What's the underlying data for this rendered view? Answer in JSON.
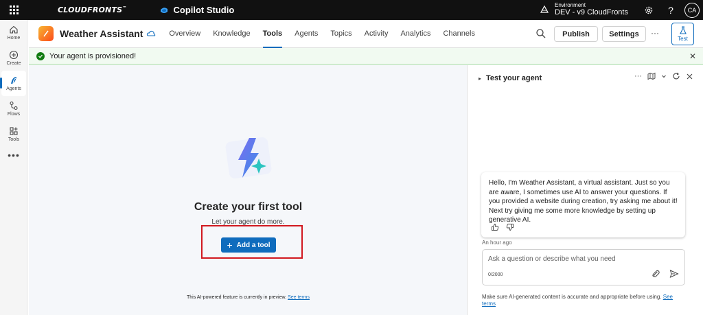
{
  "topbar": {
    "brand": "CLOUDFRONTS",
    "brand_mark": "™",
    "product": "Copilot Studio",
    "env_label": "Environment",
    "env_value": "DEV - v9 CloudFronts",
    "avatar_initials": "CA"
  },
  "rail": {
    "items": [
      {
        "label": "Home",
        "icon": "home-icon"
      },
      {
        "label": "Create",
        "icon": "plus-circle-icon"
      },
      {
        "label": "Agents",
        "icon": "agents-icon"
      },
      {
        "label": "Flows",
        "icon": "flows-icon"
      },
      {
        "label": "Tools",
        "icon": "tools-icon"
      }
    ],
    "more": "•••"
  },
  "header": {
    "agent_name": "Weather Assistant",
    "tabs": [
      {
        "label": "Overview"
      },
      {
        "label": "Knowledge"
      },
      {
        "label": "Tools"
      },
      {
        "label": "Agents"
      },
      {
        "label": "Topics"
      },
      {
        "label": "Activity"
      },
      {
        "label": "Analytics"
      },
      {
        "label": "Channels"
      }
    ],
    "active_tab": "Tools",
    "publish_label": "Publish",
    "settings_label": "Settings",
    "more": "···",
    "test_label": "Test"
  },
  "banner": {
    "text": "Your agent is provisioned!"
  },
  "main": {
    "title": "Create your first tool",
    "subtitle": "Let your agent do more.",
    "add_label": "Add a tool",
    "add_plus": "+",
    "preview_text": "This AI-powered feature is currently in preview.",
    "preview_link": "See terms"
  },
  "panel": {
    "caret": "▸",
    "title": "Test your agent",
    "message": "Hello, I'm Weather Assistant, a virtual assistant. Just so you are aware, I sometimes use AI to answer your questions. If you provided a website during creation, try asking me about it! Next try giving me some more knowledge by setting up generative AI.",
    "timestamp": "An hour ago",
    "input_placeholder": "Ask a question or describe what you need",
    "char_count": "0/2000",
    "disclaimer": "Make sure AI-generated content is accurate and appropriate before using.",
    "disclaimer_link": "See terms"
  },
  "colors": {
    "accent": "#0f6cbd",
    "highlight": "#d1181f",
    "success": "#107c10"
  }
}
